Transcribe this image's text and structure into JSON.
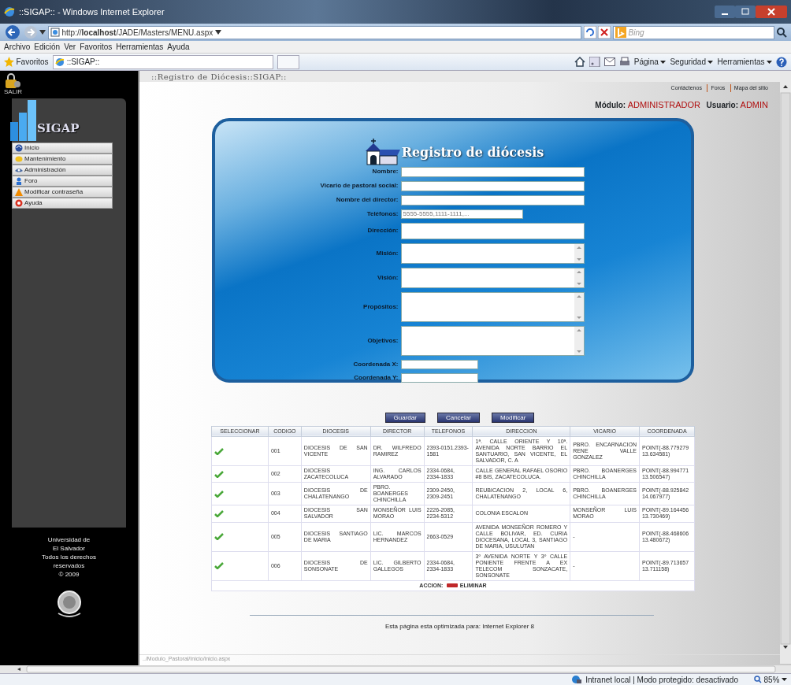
{
  "window": {
    "title": "::SIGAP:: - Windows Internet Explorer"
  },
  "address_bar": {
    "url": "http://**localhost**/JADE/Masters/MENU.aspx",
    "search_placeholder": "Bing"
  },
  "menu_bar": [
    "Archivo",
    "Edición",
    "Ver",
    "Favoritos",
    "Herramientas",
    "Ayuda"
  ],
  "favorites_bar": {
    "favorites": "Favoritos",
    "tab": "::SIGAP::",
    "commands": [
      "Página",
      "Seguridad",
      "Herramientas"
    ]
  },
  "sidebar": {
    "exit_label": "SALIR",
    "logo": "SIGAP",
    "items": [
      {
        "label": "Inicio",
        "kind": "home"
      },
      {
        "label": "Mantenimiento",
        "kind": "maintenance"
      },
      {
        "label": "Administración",
        "kind": "admin"
      },
      {
        "label": "Foro",
        "kind": "forum"
      },
      {
        "label": "Modificar contraseña",
        "kind": "warning"
      },
      {
        "label": "Ayuda",
        "kind": "help"
      }
    ],
    "footer": [
      "Universidad de",
      "El Salvador",
      "Todos los derechos",
      "reservados",
      "© 2009"
    ]
  },
  "page": {
    "title": "::Registro de Diócesis::SIGAP::",
    "links": [
      "Contáctenos",
      "Foros",
      "Mapa del sitio"
    ],
    "module_label": "Módulo:",
    "module": "ADMINISTRADOR",
    "user_label": "Usuario:",
    "user": "ADMIN"
  },
  "form": {
    "title": "Registro de diócesis",
    "fields": [
      {
        "label": "Nombre:",
        "kind": "text"
      },
      {
        "label": "Vicario de pastoral social:",
        "kind": "text"
      },
      {
        "label": "Nombre del director:",
        "kind": "text"
      },
      {
        "label": "Teléfonos:",
        "kind": "short",
        "placeholder": "5555-5555,1111-1111,..."
      },
      {
        "label": "Dirección:",
        "kind": "tall"
      },
      {
        "label": "Misión:",
        "kind": "memo"
      },
      {
        "label": "Visión:",
        "kind": "memo"
      },
      {
        "label": "Propósitos:",
        "kind": "memo_large"
      },
      {
        "label": "Objetivos:",
        "kind": "memo_large"
      },
      {
        "label": "Coordenada X:",
        "kind": "coord"
      },
      {
        "label": "Coordenada Y:",
        "kind": "coord"
      }
    ]
  },
  "buttons": [
    "Guardar",
    "Cancelar",
    "Modificar"
  ],
  "table": {
    "columns": [
      "SELECCIONAR",
      "CODIGO",
      "DIOCESIS",
      "DIRECTOR",
      "TELEFONOS",
      "DIRECCION",
      "VICARIO",
      "COORDENADA"
    ],
    "rows": [
      [
        "",
        "001",
        "DIOCESIS DE SAN VICENTE",
        "DR. WILFREDO RAMIREZ",
        "2393-0151.2393-1581",
        "1ª. CALLE ORIENTE Y 10ª. AVENIDA NORTE BARRIO EL SANTUARIO, SAN VICENTE, EL SALVADOR, C. A",
        "PBRO. ENCARNACION RENE VALLE GONZALEZ",
        "POINT(-88.779279 13.634581)"
      ],
      [
        "",
        "002",
        "DIOCESIS ZACATECOLUCA",
        "ING. CARLOS ALVARADO",
        "2334-0684, 2334-1833",
        "CALLE GENERAL RAFAEL OSORIO #8 BIS, ZACATECOLUCA.",
        "PBRO. BOANERGES CHINCHILLA",
        "POINT(-88.994771 13.506547)"
      ],
      [
        "",
        "003",
        "DIOCESIS DE CHALATENANGO",
        "PBRO. BOANERGES CHINCHILLA",
        "2309-2450, 2309-2451",
        "REUBICACION 2, LOCAL 6, CHALATENANGO",
        "PBRO. BOANERGES CHINCHILLA",
        "POINT(-88.925842 14.067977)"
      ],
      [
        "",
        "004",
        "DIOCESIS SAN SALVADOR",
        "MONSEÑOR LUIS MORAO",
        "2226-2085, 2234-5312",
        "COLONIA ESCALON",
        "MONSEÑOR LUIS MORAO",
        "POINT(-89.164456 13.730469)"
      ],
      [
        "",
        "005",
        "DIOCESIS SANTIAGO DE MARIA",
        "LIC. MARCOS HERNANDEZ",
        "2663-0529",
        "AVENIDA MONSEÑOR ROMERO Y CALLE BOLIVAR, ED. CURIA DIOCESANA, LOCAL 3, SANTIAGO DE MARIA, USULUTAN",
        "-",
        "POINT(-88.468606 13.480672)"
      ],
      [
        "",
        "006",
        "DIOCESIS DE SONSONATE",
        "LIC. GILBERTO GALLEGOS",
        "2334-0684, 2334-1833",
        "3º AVENIDA NORTE Y 3º CALLE PONIENTE FRENTE A EX TELECOM SONZACATE, SONSONATE",
        "-",
        "POINT(-89.713657 13.711158)"
      ]
    ],
    "footer_label": "ACCION:",
    "footer_action": "ELIMINAR"
  },
  "footer": "Esta página esta optimizada para: Internet Explorer 8",
  "status_path": "../Modulo_Pastoral/Inicio/inicio.aspx",
  "status_bar": {
    "zone": "Intranet local | Modo protegido: desactivado",
    "zoom": "85%"
  }
}
